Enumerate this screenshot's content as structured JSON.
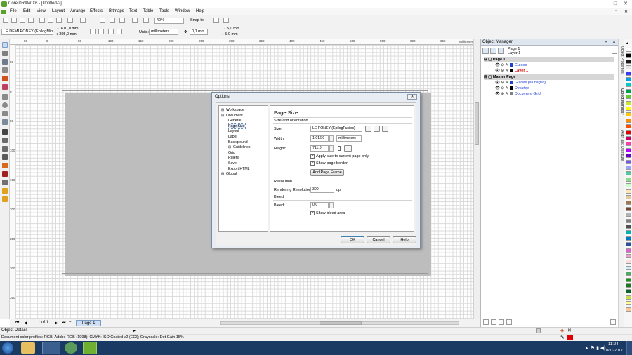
{
  "window": {
    "title": "CorelDRAW X6 - [Untitled-2]"
  },
  "menu": [
    "File",
    "Edit",
    "View",
    "Layout",
    "Arrange",
    "Effects",
    "Bitmaps",
    "Text",
    "Table",
    "Tools",
    "Window",
    "Help"
  ],
  "toolbar": {
    "zoom": "40%",
    "snap_to": "Snap to",
    "paper_preset": "LE DEMI PONEY (EpilogMini)",
    "width_value": "610,0 mm",
    "height_value": "305,0 mm",
    "units_label": "Units:",
    "units_value": "millimeters",
    "nudge": "0,1 mm",
    "dup_x": "5,0 mm",
    "dup_y": "5,0 mm"
  },
  "rulers": {
    "h_labels": [
      "50",
      "0",
      "50",
      "100",
      "150",
      "200",
      "250",
      "300",
      "350",
      "400",
      "450",
      "500",
      "550",
      "600",
      "650"
    ],
    "h_unit": "millimeters",
    "v_labels": [
      "50",
      "0",
      "50",
      "100",
      "150",
      "200",
      "250",
      "300",
      "350"
    ],
    "v_unit": "millimeters"
  },
  "docker": {
    "title": "Object Manager",
    "current_page": "Page 1",
    "current_layer": "Layer 1",
    "pages": [
      {
        "name": "Page 1",
        "layers": [
          {
            "name": "Guides",
            "color": "#1f3fd6",
            "style": "normal"
          },
          {
            "name": "Layer 1",
            "color": "#000000",
            "style": "red"
          }
        ]
      },
      {
        "name": "Master Page",
        "layers": [
          {
            "name": "Guides (all pages)",
            "color": "#1f3fd6",
            "style": "italic"
          },
          {
            "name": "Desktop",
            "color": "#000000",
            "style": "italic"
          },
          {
            "name": "Document Grid",
            "color": "#808080",
            "style": "italic"
          }
        ]
      }
    ],
    "side_tabs": [
      "Object Properties",
      "Object Manager",
      "Align and Distribute"
    ]
  },
  "palette_colors": [
    "#ffffff",
    "#000000",
    "#1a1a1a",
    "#e6e6e6",
    "#3a3aff",
    "#00a0e6",
    "#00c8c8",
    "#00a050",
    "#64c832",
    "#c8e632",
    "#ffff00",
    "#ffc800",
    "#ff8c00",
    "#ff5000",
    "#e60000",
    "#c80064",
    "#ff3caa",
    "#b400ff",
    "#6400c8",
    "#7850ff",
    "#a0a0ff",
    "#50c8a0",
    "#8cdc8c",
    "#c8ffc8",
    "#ffe6b4",
    "#e6c8a0",
    "#a07850",
    "#784628",
    "#b4b4b4",
    "#828282",
    "#505050",
    "#00b4b4",
    "#0078c8",
    "#2850a0",
    "#dc64c8",
    "#f0a0c8",
    "#ffdcdc",
    "#c8f0ff",
    "#50aa64",
    "#149614",
    "#1e781e",
    "#0a6428",
    "#c8dc50",
    "#ffff96",
    "#ffc896"
  ],
  "page_nav": {
    "indicator": "1 of 1",
    "tab": "Page 1"
  },
  "status": {
    "object_details": "Object Details",
    "color_profiles": "Document color proflies: RGB: Adobe RGB (1998); CMYK: ISO Coated v2 (ECI); Grayscale: Dot Gain 15%"
  },
  "taskbar": {
    "time": "11:24",
    "date": "10/11/2017"
  },
  "dialog": {
    "title": "Options",
    "close": "✕",
    "tree": [
      {
        "label": "Workspace",
        "level": 0,
        "expander": "+"
      },
      {
        "label": "Document",
        "level": 0,
        "expander": "−"
      },
      {
        "label": "General",
        "level": 1
      },
      {
        "label": "Page Size",
        "level": 1,
        "selected": true
      },
      {
        "label": "Layout",
        "level": 1
      },
      {
        "label": "Label",
        "level": 1
      },
      {
        "label": "Background",
        "level": 1
      },
      {
        "label": "Guidelines",
        "level": 1,
        "expander": "+"
      },
      {
        "label": "Grid",
        "level": 1
      },
      {
        "label": "Rulers",
        "level": 1
      },
      {
        "label": "Save",
        "level": 1
      },
      {
        "label": "Export HTML",
        "level": 1
      },
      {
        "label": "Global",
        "level": 0,
        "expander": "+"
      }
    ],
    "heading": "Page Size",
    "size_section": "Size and orientation",
    "size_label": "Size:",
    "size_value": "LE PONEY (EpilogFusion)",
    "width_label": "Width:",
    "width_value": "1 016,0",
    "units_value": "millimeters",
    "height_label": "Height:",
    "height_value": "711,0",
    "apply_label": "Apply size to current page only",
    "show_border_label": "Show page border",
    "add_frame_label": "Add Page Frame",
    "resolution_section": "Resolution",
    "rendering_label": "Rendering Resolution:",
    "rendering_value": "300",
    "rendering_unit": "dpi",
    "bleed_section": "Bleed",
    "bleed_label": "Bleed:",
    "bleed_value": "0,0",
    "show_bleed_label": "Show bleed area",
    "ok": "OK",
    "cancel": "Cancel",
    "help": "Help"
  }
}
